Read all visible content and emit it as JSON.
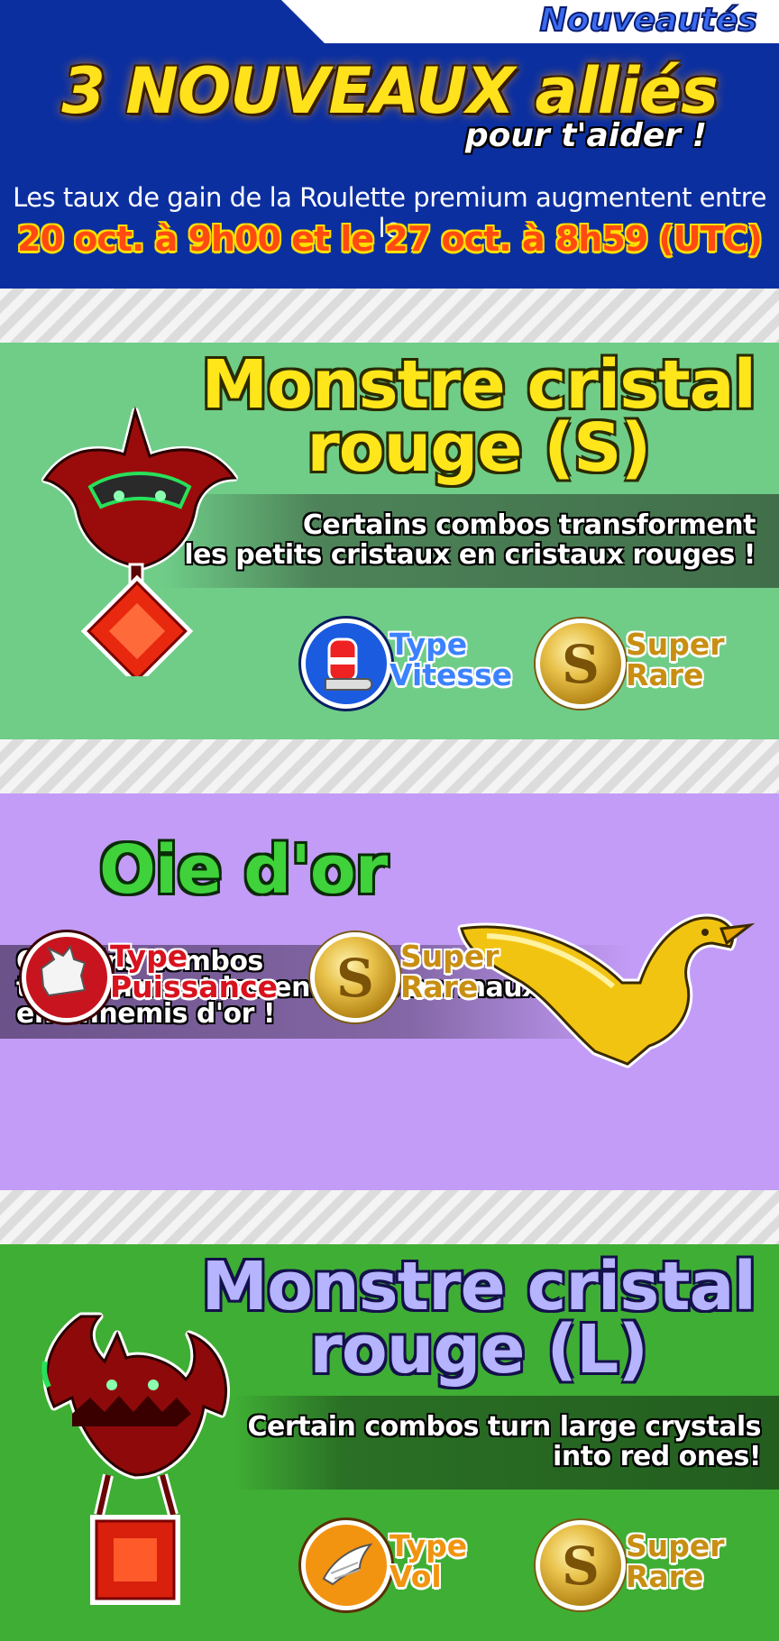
{
  "header": {
    "tag": "Nouveautés",
    "title": "3 NOUVEAUX alliés",
    "subtitle": "pour t'aider !",
    "rate_text": "Les taux de gain de la Roulette premium augmentent entre le",
    "date_text": "20 oct. à 9h00 et le 27 oct. à 8h59 (UTC)"
  },
  "cards": [
    {
      "title_line1": "Monstre cristal",
      "title_line2": "rouge (S)",
      "desc_line1": "Certains combos transforment",
      "desc_line2": "les petits cristaux en cristaux rouges !",
      "type_label1": "Type",
      "type_label2": "Vitesse",
      "type_icon": "speed-shoe-icon",
      "rarity_label1": "Super",
      "rarity_label2": "Rare",
      "rarity_icon": "s-coin-icon",
      "bg": "#6fcd88"
    },
    {
      "title_line1": "Oie d'or",
      "desc_line1": "Certains combos",
      "desc_line2": "transforment les ennemis normaux",
      "desc_line3": "en ennemis d'or !",
      "type_label1": "Type",
      "type_label2": "Puissance",
      "type_icon": "power-fist-icon",
      "rarity_label1": "Super",
      "rarity_label2": "Rare",
      "rarity_icon": "s-coin-icon",
      "bg": "#c39cf7"
    },
    {
      "title_line1": "Monstre cristal",
      "title_line2": "rouge (L)",
      "desc_line1": "Certain combos turn large crystals",
      "desc_line2": "into red ones!",
      "type_label1": "Type",
      "type_label2": "Vol",
      "type_icon": "flight-wing-icon",
      "rarity_label1": "Super",
      "rarity_label2": "Rare",
      "rarity_icon": "s-coin-icon",
      "bg": "#3fae34"
    }
  ],
  "badge_s_glyph": "S"
}
